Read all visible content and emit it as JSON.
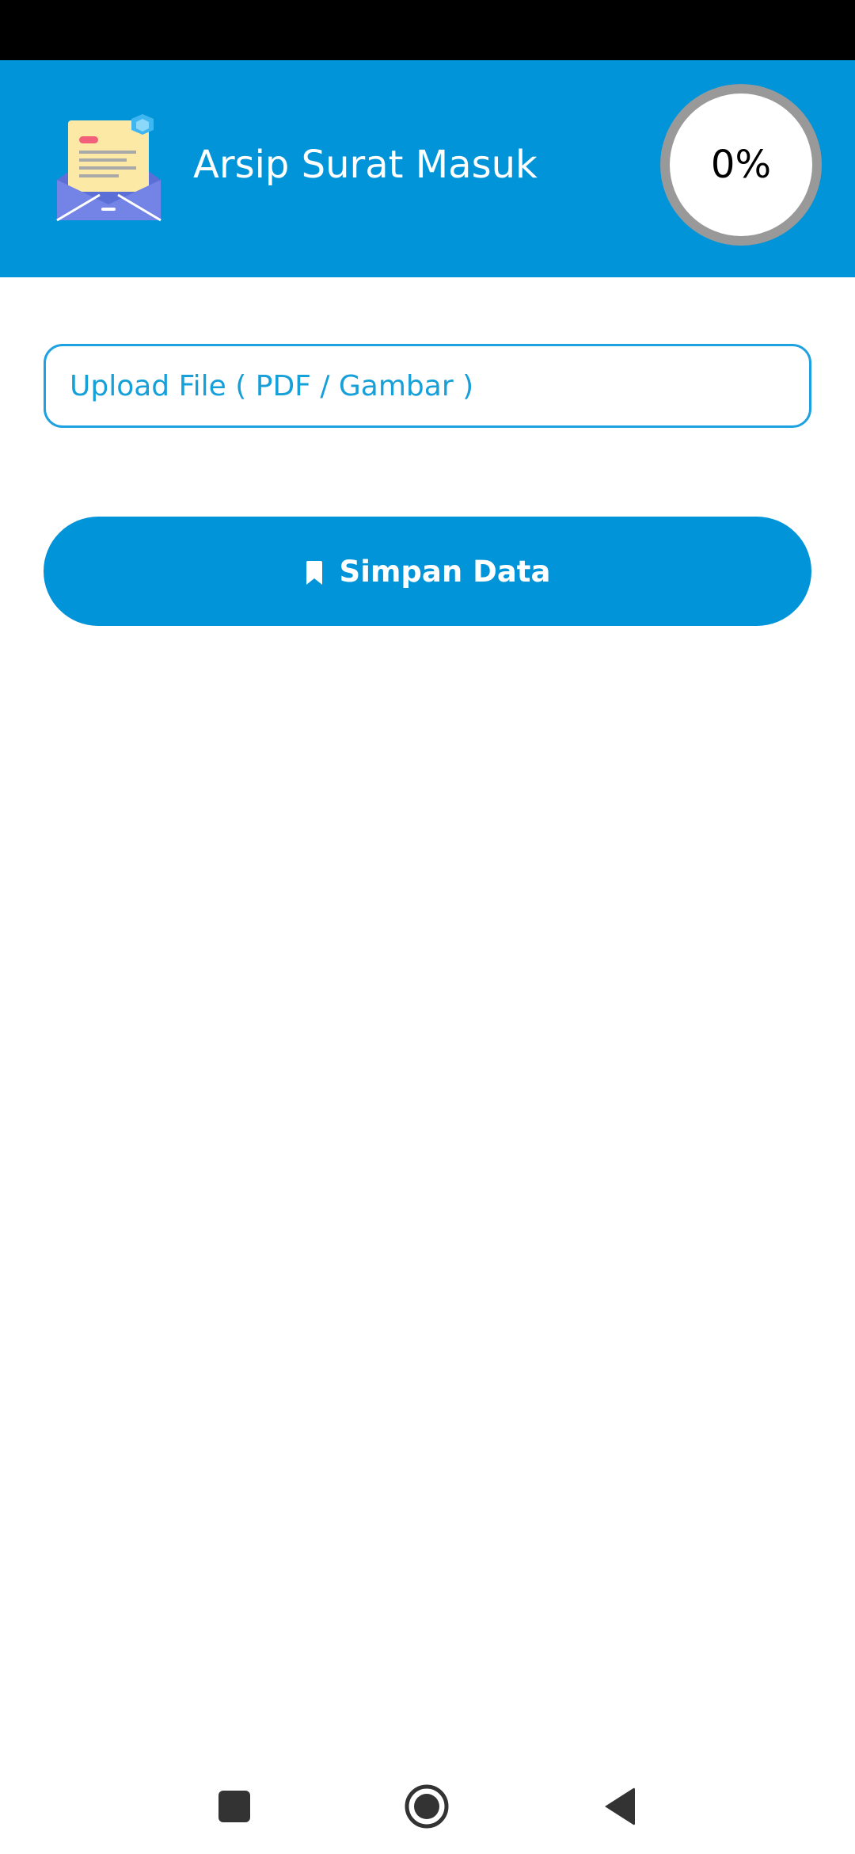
{
  "app": {
    "title": "Arsip Surat Masuk",
    "header_color": "#0194d9",
    "logo_icon": "open-envelope-letter-icon"
  },
  "progress": {
    "text": "0%",
    "value_percent": 0
  },
  "upload": {
    "placeholder": "Upload File ( PDF / Gambar )",
    "value": ""
  },
  "actions": {
    "save_label": "Simpan Data",
    "save_icon": "bookmark-icon"
  },
  "system_nav": {
    "recents_icon": "square-icon",
    "home_icon": "circle-home-icon",
    "back_icon": "triangle-back-icon"
  }
}
